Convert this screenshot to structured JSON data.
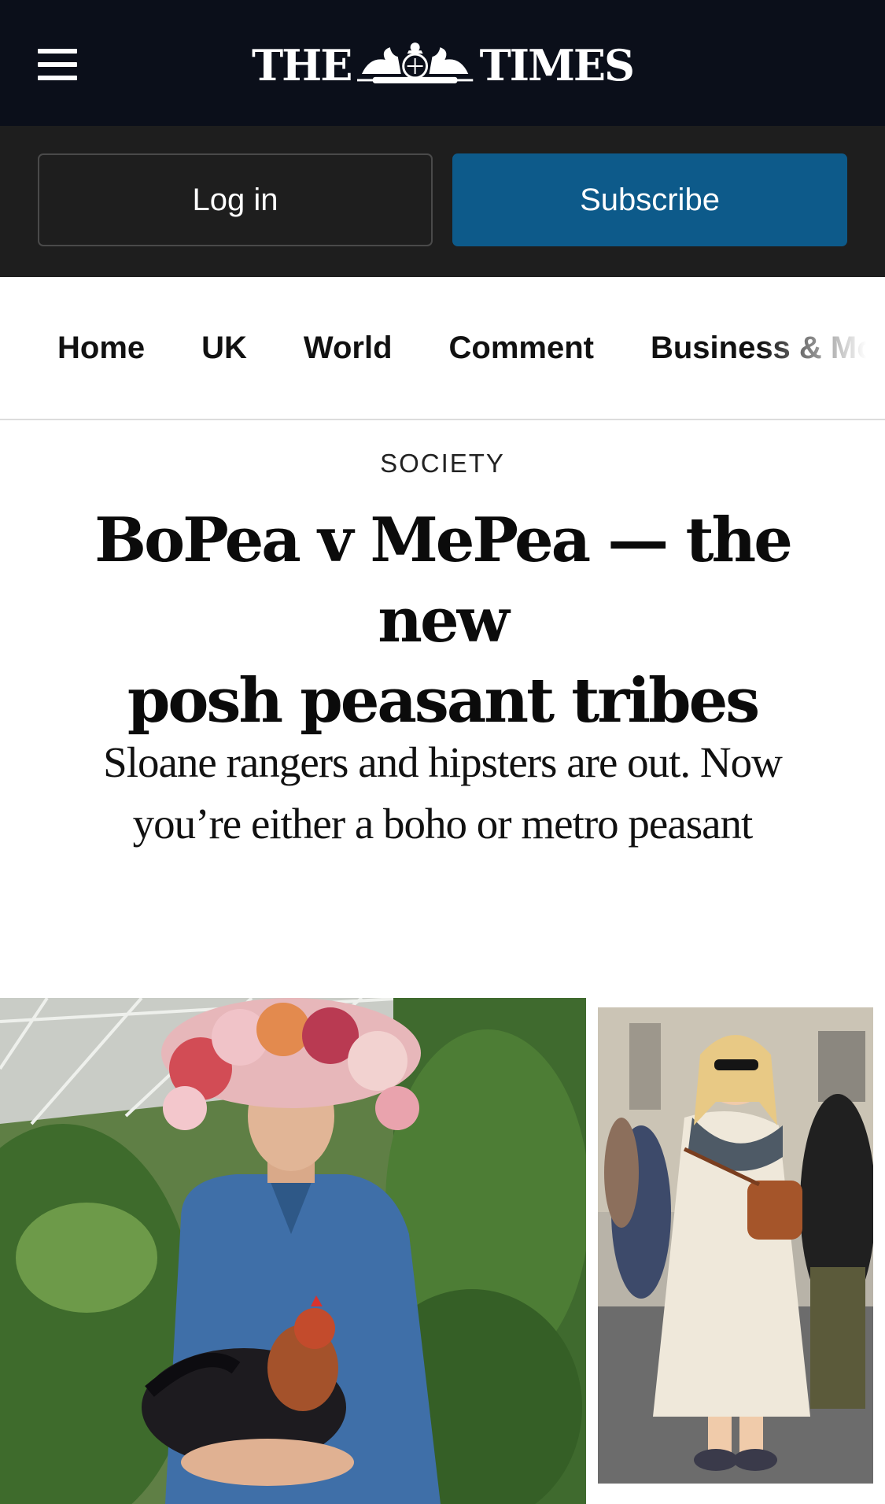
{
  "header": {
    "menu_icon": "hamburger-menu-icon",
    "masthead_left": "THE",
    "masthead_right": "TIMES",
    "crest_icon": "royal-crest-icon"
  },
  "auth": {
    "login_label": "Log in",
    "subscribe_label": "Subscribe",
    "subscribe_color": "#0d5a8a"
  },
  "nav": {
    "items": [
      "Home",
      "UK",
      "World",
      "Comment",
      "Business & Money"
    ]
  },
  "article": {
    "section": "SOCIETY",
    "headline_line1": "BoPea v MePea — the new",
    "headline_line2": "posh peasant tribes",
    "standfirst_line1": "Sloane rangers and hipsters are out. Now",
    "standfirst_line2": "you’re either a boho or metro peasant"
  },
  "images": {
    "main_photo": "man-with-flower-crown-holding-chicken-photo",
    "side_photo": "woman-in-white-dress-street-style-photo"
  }
}
